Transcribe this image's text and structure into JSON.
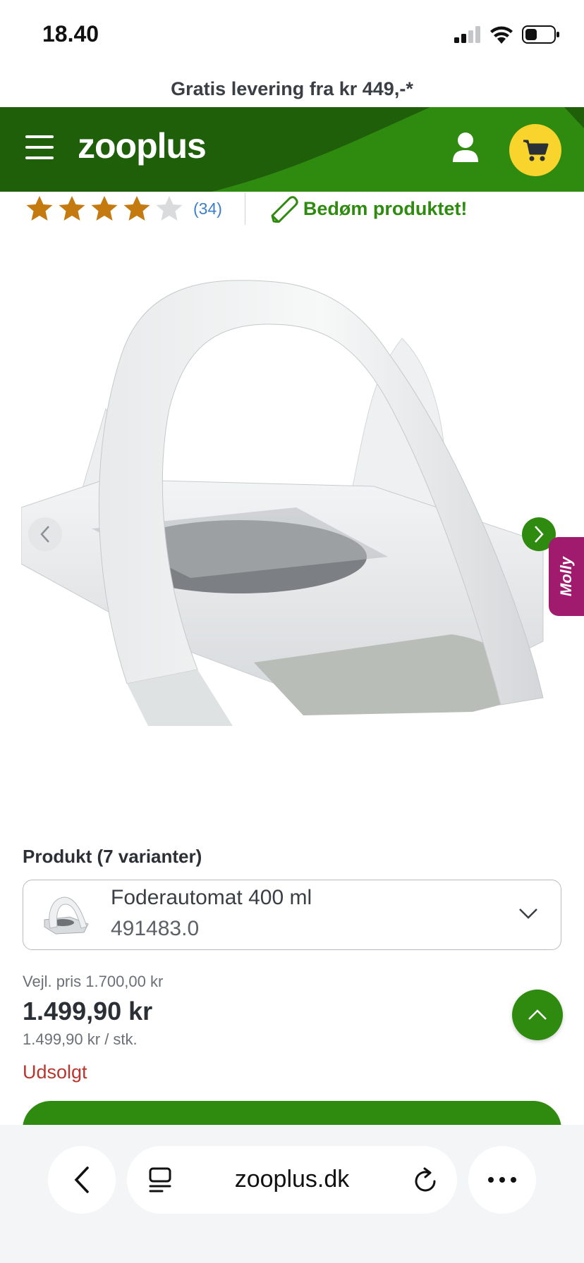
{
  "status_bar": {
    "time": "18.40"
  },
  "promo": {
    "text": "Gratis levering fra kr 449,-*"
  },
  "header": {
    "logo": "zooplus",
    "brand_green": "#2e8b10",
    "cart_yellow": "#f8d42c"
  },
  "rating": {
    "stars": 4,
    "max_stars": 5,
    "count_label": "(34)",
    "rate_label": "Bedøm produktet!"
  },
  "gallery": {
    "side_tab_label": "Molly"
  },
  "product": {
    "variant_label": "Produkt (7 varianter)",
    "variant_name": "Foderautomat 400 ml",
    "variant_sku": "491483.0"
  },
  "pricing": {
    "rrp": "Vejl. pris 1.700,00 kr",
    "price": "1.499,90 kr",
    "unit_price": "1.499,90 kr / stk.",
    "stock_status": "Udsolgt"
  },
  "browser": {
    "url": "zooplus.dk"
  }
}
